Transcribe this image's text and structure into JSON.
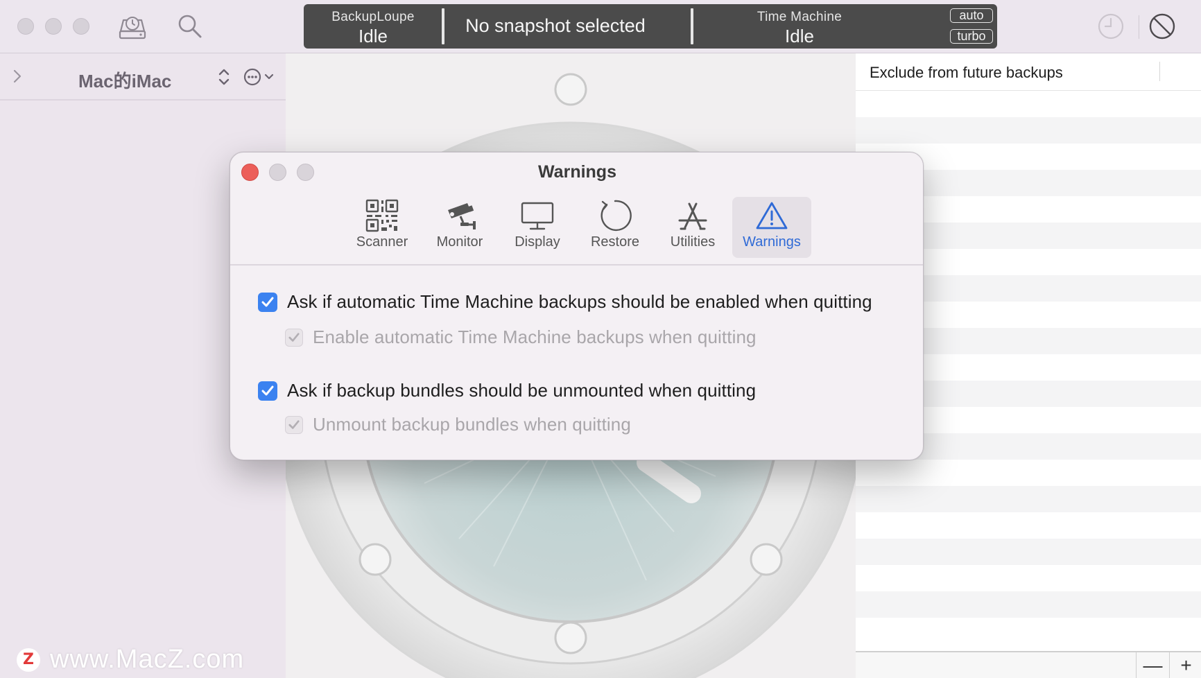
{
  "toolbar": {
    "status": {
      "backuploupe_label": "BackupLoupe",
      "backuploupe_state": "Idle",
      "snapshot_text": "No snapshot selected",
      "timemachine_label": "Time Machine",
      "timemachine_state": "Idle",
      "badge_auto": "auto",
      "badge_turbo": "turbo"
    },
    "icons": [
      "backup-disk-icon",
      "search-icon",
      "clock-icon",
      "prohibited-icon"
    ]
  },
  "sidebar": {
    "title": "Mac的iMac"
  },
  "right_panel": {
    "column_header": "Exclude from future backups",
    "remove_label": "—",
    "add_label": "+"
  },
  "dialog": {
    "title": "Warnings",
    "tabs": [
      {
        "label": "Scanner",
        "icon": "qr-code-icon"
      },
      {
        "label": "Monitor",
        "icon": "security-camera-icon"
      },
      {
        "label": "Display",
        "icon": "monitor-icon"
      },
      {
        "label": "Restore",
        "icon": "restore-icon"
      },
      {
        "label": "Utilities",
        "icon": "app-store-tools-icon"
      },
      {
        "label": "Warnings",
        "icon": "warning-icon",
        "active": true
      }
    ],
    "options": [
      {
        "label": "Ask if automatic Time Machine backups should be enabled when quitting",
        "checked": true,
        "enabled": true
      },
      {
        "label": "Enable automatic Time Machine backups when quitting",
        "checked": true,
        "enabled": false
      },
      {
        "label": "Ask if backup bundles should be unmounted when quitting",
        "checked": true,
        "enabled": true
      },
      {
        "label": "Unmount backup bundles when quitting",
        "checked": true,
        "enabled": false
      }
    ]
  },
  "watermark": {
    "logo": "Z",
    "text": "www.MacZ.com"
  },
  "colors": {
    "accent": "#3b82f0",
    "close": "#ec5f5a",
    "active_tab_label": "#2f6ad6"
  }
}
